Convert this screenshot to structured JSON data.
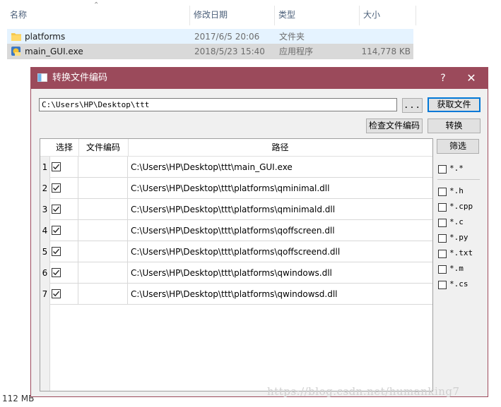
{
  "explorer": {
    "columns": {
      "name": "名称",
      "date": "修改日期",
      "type": "类型",
      "size": "大小"
    },
    "files": [
      {
        "name": "platforms",
        "date": "2017/6/5 20:06",
        "type": "文件夹",
        "size": "",
        "icon": "folder-icon"
      },
      {
        "name": "main_GUI.exe",
        "date": "2018/5/23 15:40",
        "type": "应用程序",
        "size": "114,778 KB",
        "icon": "exe-icon"
      }
    ],
    "status": "112 MB"
  },
  "dialog": {
    "title": "转换文件编码",
    "help_label": "?",
    "close_label": "✕",
    "path_value": "C:\\Users\\HP\\Desktop\\ttt",
    "browse_label": "...",
    "get_file_label": "获取文件",
    "check_encoding_label": "检查文件编码",
    "convert_label": "转换",
    "filter_label": "筛选",
    "accent_color": "#9b4a5b"
  },
  "table": {
    "headers": {
      "select": "选择",
      "encoding": "文件编码",
      "path": "路径"
    },
    "rows": [
      {
        "num": "1",
        "checked": true,
        "encoding": "",
        "path": "C:\\Users\\HP\\Desktop\\ttt\\main_GUI.exe"
      },
      {
        "num": "2",
        "checked": true,
        "encoding": "",
        "path": "C:\\Users\\HP\\Desktop\\ttt\\platforms\\qminimal.dll"
      },
      {
        "num": "3",
        "checked": true,
        "encoding": "",
        "path": "C:\\Users\\HP\\Desktop\\ttt\\platforms\\qminimald.dll"
      },
      {
        "num": "4",
        "checked": true,
        "encoding": "",
        "path": "C:\\Users\\HP\\Desktop\\ttt\\platforms\\qoffscreen.dll"
      },
      {
        "num": "5",
        "checked": true,
        "encoding": "",
        "path": "C:\\Users\\HP\\Desktop\\ttt\\platforms\\qoffscreend.dll"
      },
      {
        "num": "6",
        "checked": true,
        "encoding": "",
        "path": "C:\\Users\\HP\\Desktop\\ttt\\platforms\\qwindows.dll"
      },
      {
        "num": "7",
        "checked": true,
        "encoding": "",
        "path": "C:\\Users\\HP\\Desktop\\ttt\\platforms\\qwindowsd.dll"
      }
    ]
  },
  "filters": {
    "all": {
      "label": "*.*",
      "checked": false
    },
    "items": [
      {
        "label": "*.h",
        "checked": false
      },
      {
        "label": "*.cpp",
        "checked": false
      },
      {
        "label": "*.c",
        "checked": false
      },
      {
        "label": "*.py",
        "checked": false
      },
      {
        "label": "*.txt",
        "checked": false
      },
      {
        "label": "*.m",
        "checked": false
      },
      {
        "label": "*.cs",
        "checked": false
      }
    ]
  },
  "watermark": "https://blog.csdn.net/humanking7"
}
